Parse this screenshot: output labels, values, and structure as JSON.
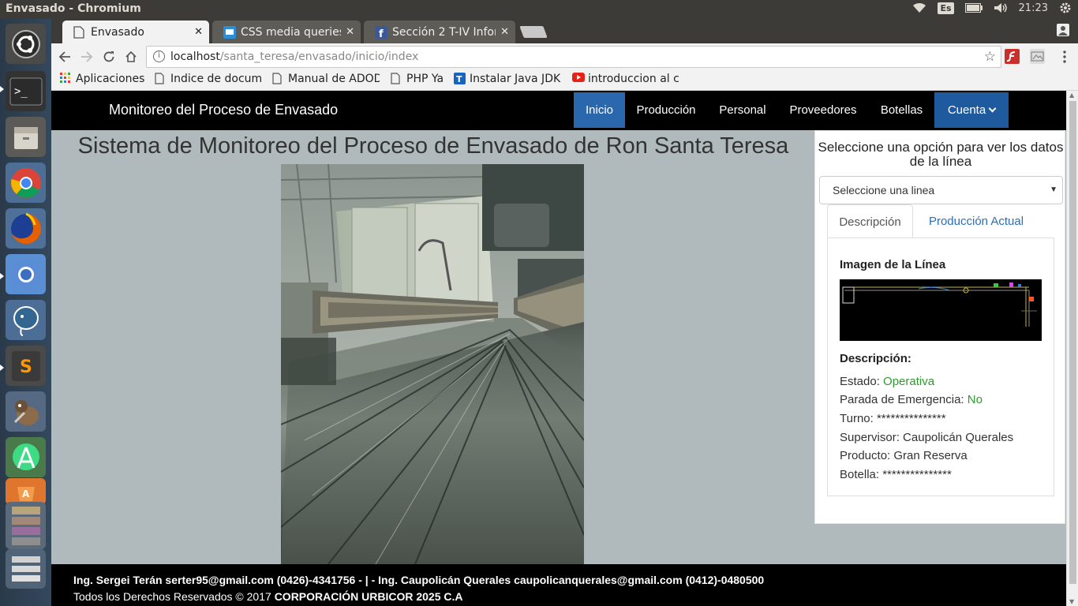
{
  "os": {
    "window_title": "Envasado - Chromium",
    "keyboard_layout": "Es",
    "clock": "21:23"
  },
  "launcher": {
    "items": [
      "ubuntu-dash-icon",
      "terminal-icon",
      "files-icon",
      "chrome-icon",
      "firefox-icon",
      "chromium-icon",
      "postgresql-icon",
      "sublime-text-icon",
      "gimp-icon",
      "android-studio-icon",
      "software-center-icon",
      "workspaces-icon",
      "trash-icon"
    ]
  },
  "browser": {
    "tabs": [
      {
        "title": "Envasado",
        "active": true
      },
      {
        "title": "CSS media queries",
        "active": false
      },
      {
        "title": "Sección 2 T-IV Infor",
        "active": false
      }
    ],
    "url_host": "localhost",
    "url_path": "/santa_teresa/envasado/inicio/index",
    "bookmarks": [
      {
        "label": "Aplicaciones",
        "icon": "apps-grid-icon"
      },
      {
        "label": "Indice de docume",
        "icon": "page-icon"
      },
      {
        "label": "Manual de ADOD",
        "icon": "page-icon"
      },
      {
        "label": "PHP Ya",
        "icon": "page-icon"
      },
      {
        "label": "Instalar Java JDK",
        "icon": "tutorial-site-icon"
      },
      {
        "label": "introduccion al c",
        "icon": "youtube-icon"
      }
    ]
  },
  "site": {
    "brand": "Monitoreo del Proceso de Envasado",
    "nav": [
      {
        "label": "Inicio",
        "active": true
      },
      {
        "label": "Producción",
        "active": false
      },
      {
        "label": "Personal",
        "active": false
      },
      {
        "label": "Proveedores",
        "active": false
      },
      {
        "label": "Botellas",
        "active": false
      },
      {
        "label": "Cuenta",
        "active": false,
        "dropdown": true
      }
    ],
    "page_title": "Sistema de Monitoreo del Proceso de Envasado de Ron Santa Teresa",
    "panel": {
      "prompt": "Seleccione una opción para ver los datos de la línea",
      "select_value": "Seleccione una linea",
      "tabs": [
        "Descripción",
        "Producción Actual"
      ],
      "image_heading": "Imagen de la Línea",
      "description_heading": "Descripción:",
      "fields": [
        {
          "label": "Estado:",
          "value": "Operativa",
          "status": true
        },
        {
          "label": "Parada de Emergencia:",
          "value": "No",
          "status": true
        },
        {
          "label": "Turno:",
          "value": "***************",
          "status": false
        },
        {
          "label": "Supervisor:",
          "value": "Caupolicán Querales",
          "status": false
        },
        {
          "label": "Producto:",
          "value": "Gran Reserva",
          "status": false
        },
        {
          "label": "Botella:",
          "value": "***************",
          "status": false
        }
      ]
    },
    "footer": {
      "line1": "Ing. Sergei Terán serter95@gmail.com (0426)-4341756 - | - Ing. Caupolicán Querales caupolicanquerales@gmail.com (0412)-0480500",
      "line2_prefix": "Todos los Derechos Reservados © 2017 ",
      "line2_company": "CORPORACIÓN URBICOR 2025 C.A"
    }
  },
  "colors": {
    "nav_active": "#2b67ad",
    "status_ok": "#2f9a2f",
    "page_bg": "#b0b9bb"
  }
}
